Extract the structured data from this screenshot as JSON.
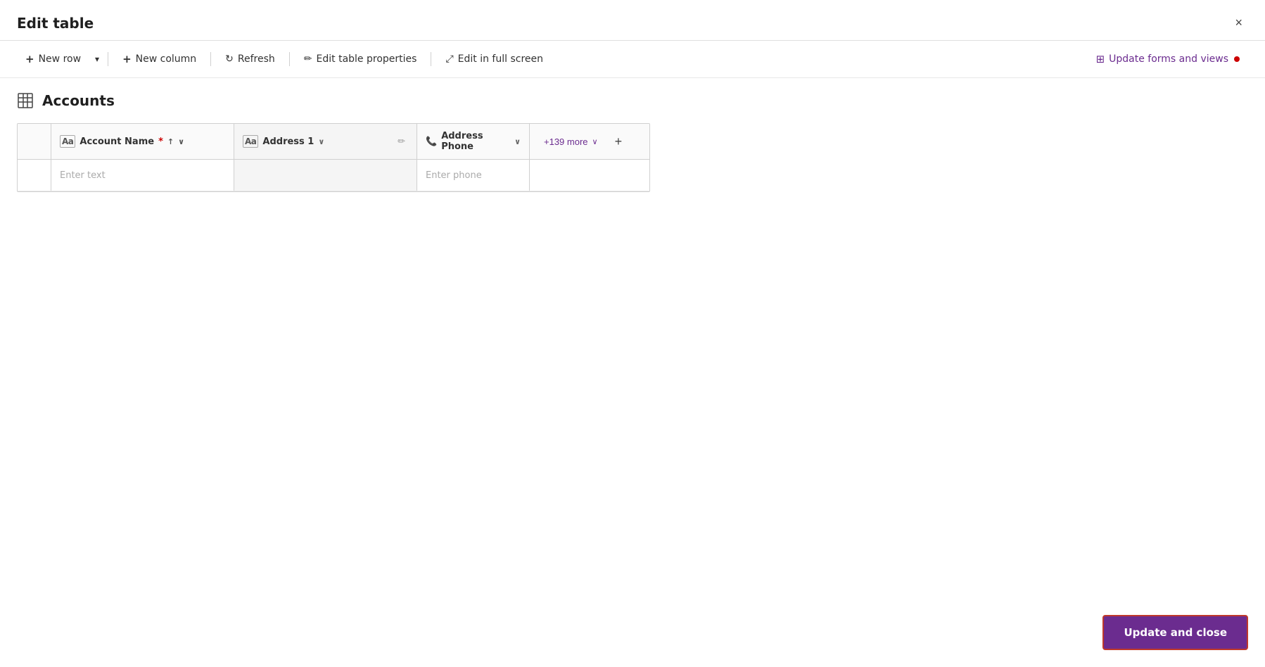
{
  "page": {
    "title": "Edit table",
    "close_label": "×"
  },
  "toolbar": {
    "new_row_label": "New row",
    "new_row_dropdown_label": "▾",
    "new_column_label": "New column",
    "refresh_label": "Refresh",
    "edit_table_properties_label": "Edit table properties",
    "edit_in_full_screen_label": "Edit in full screen",
    "update_forms_label": "Update forms and views"
  },
  "table": {
    "title": "Accounts",
    "columns": [
      {
        "id": "account_name",
        "label": "Account Name",
        "required": true,
        "type_icon": "text-icon",
        "placeholder": "Enter text",
        "sortable": true
      },
      {
        "id": "address1",
        "label": "Address 1",
        "required": false,
        "type_icon": "text-icon",
        "placeholder": "",
        "sortable": false
      },
      {
        "id": "address_phone",
        "label": "Address Phone",
        "required": false,
        "type_icon": "phone-icon",
        "placeholder": "Enter phone",
        "sortable": false,
        "has_dropdown": true
      }
    ],
    "more_columns_label": "+139 more",
    "add_column_label": "+"
  },
  "footer": {
    "update_close_label": "Update and close"
  }
}
